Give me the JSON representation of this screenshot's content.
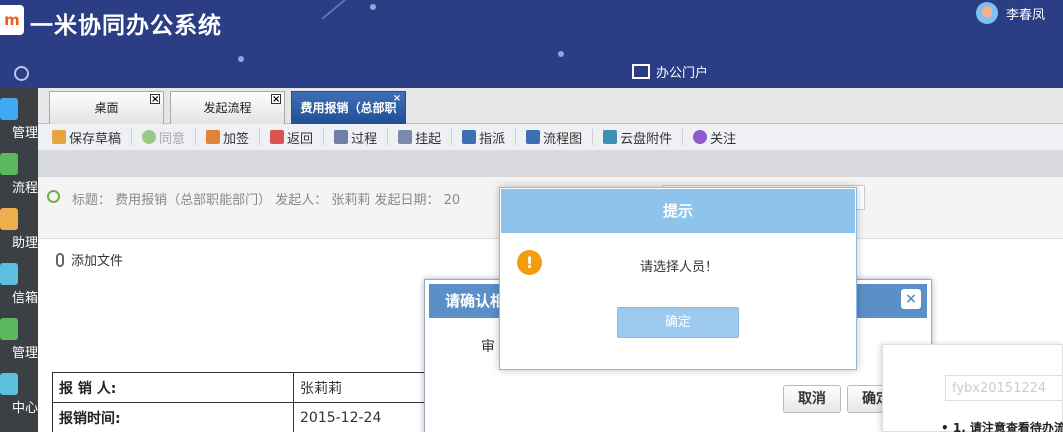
{
  "app": {
    "logo_text": "m",
    "title": "一米协同办公系统",
    "user_name": "李春凤",
    "portal_label": "办公门户"
  },
  "sidebar": {
    "items": [
      {
        "label": "文档管理",
        "icon": "folder-icon",
        "color": "#3fa9f5"
      },
      {
        "label": "工作流程",
        "icon": "flow-icon",
        "color": "#5cb85c"
      },
      {
        "label": "个人助理",
        "icon": "person-icon",
        "color": "#f0ad4e"
      },
      {
        "label": "个人信箱",
        "icon": "mail-icon",
        "color": "#5bc0de"
      },
      {
        "label": "资产管理",
        "icon": "building-icon",
        "color": "#5cb85c"
      },
      {
        "label": "人事中心",
        "icon": "people-icon",
        "color": "#5bc0de"
      }
    ],
    "visible_labels": [
      "管理",
      "流程",
      "助理",
      "信箱",
      "管理",
      "中心"
    ]
  },
  "tabs": [
    {
      "label": "桌面",
      "active": false
    },
    {
      "label": "发起流程",
      "active": false
    },
    {
      "label": "费用报销（总部职",
      "active": true
    }
  ],
  "tab_close_glyph": "×",
  "toolbar": {
    "buttons": [
      {
        "label": "保存草稿",
        "icon": "save-icon",
        "color": "#e8a33d",
        "disabled": false
      },
      {
        "label": "同意",
        "icon": "check-icon",
        "color": "#9bc985",
        "disabled": true
      },
      {
        "label": "加签",
        "icon": "add-sign-icon",
        "color": "#e0823a",
        "disabled": false
      },
      {
        "label": "返回",
        "icon": "return-icon",
        "color": "#d9534f",
        "disabled": false
      },
      {
        "label": "过程",
        "icon": "process-icon",
        "color": "#6f7fa8",
        "disabled": false
      },
      {
        "label": "挂起",
        "icon": "lock-icon",
        "color": "#7a8aa8",
        "disabled": false
      },
      {
        "label": "指派",
        "icon": "assign-icon",
        "color": "#3d6fb5",
        "disabled": false
      },
      {
        "label": "流程图",
        "icon": "flowchart-icon",
        "color": "#3d6fb5",
        "disabled": false
      },
      {
        "label": "云盘附件",
        "icon": "cloud-icon",
        "color": "#3d8fb5",
        "disabled": false
      },
      {
        "label": "关注",
        "icon": "plus-circle-icon",
        "color": "#8e5bc8",
        "disabled": false
      }
    ]
  },
  "info": {
    "text": "标题： 费用报销（总部职能部门）   发起人： 张莉莉  发起日期： 20"
  },
  "attach": {
    "label": "添加文件"
  },
  "form": {
    "rows": [
      {
        "label": "报 销 人:",
        "value": "张莉莉"
      },
      {
        "label": "报销时间:",
        "value": "2015-12-24"
      }
    ]
  },
  "confirm_dialog": {
    "title": "请确认相",
    "body": "审",
    "close_glyph": "×",
    "cancel_label": "取消",
    "ok_label": "确定"
  },
  "right_panel": {
    "code": "fybx20151224",
    "tip": "• 1. 请注意查看待办流"
  },
  "alert": {
    "title": "提示",
    "icon_glyph": "!",
    "message": "请选择人员！",
    "ok_label": "确定"
  },
  "colors": {
    "header_bg": "#2a3d85",
    "sidebar_bg": "#3a4044",
    "active_tab": "#2a5aa0",
    "alert_head": "#8ec3ec",
    "warning": "#f39c12"
  }
}
